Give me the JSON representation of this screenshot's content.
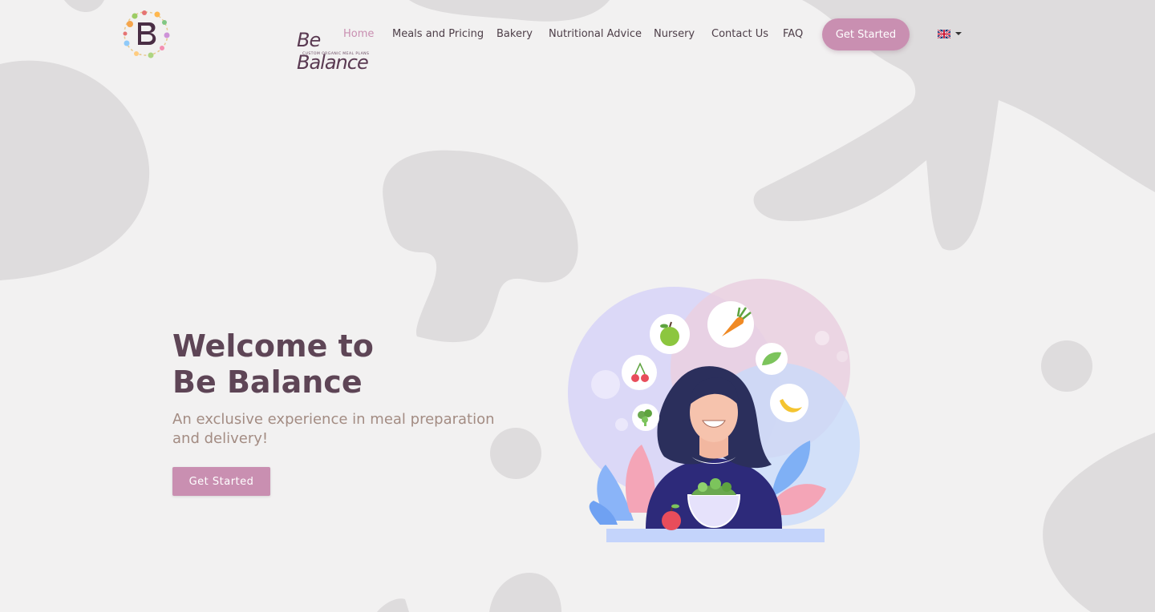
{
  "brand": {
    "name": "Be Balance",
    "tagline": "CUSTOM ORGANIC MEAL PLANS",
    "colors": {
      "accent": "#c98fb1",
      "heading": "#5e4556",
      "subtext": "#a38c83",
      "background": "#f2f1f1"
    }
  },
  "nav": {
    "items": [
      {
        "label": "Home",
        "active": true
      },
      {
        "label": "Meals and Pricing"
      },
      {
        "label": "Bakery"
      },
      {
        "label": "Nutritional Advice"
      },
      {
        "label": "Nursery"
      },
      {
        "label": "Contact Us"
      },
      {
        "label": "FAQ"
      }
    ],
    "cta": "Get Started",
    "language": {
      "selected": "en",
      "icon": "uk-flag-icon"
    }
  },
  "hero": {
    "title_line1": "Welcome to",
    "title_line2": "Be Balance",
    "subtitle": "An exclusive experience in meal preparation and delivery!",
    "cta": "Get Started"
  }
}
